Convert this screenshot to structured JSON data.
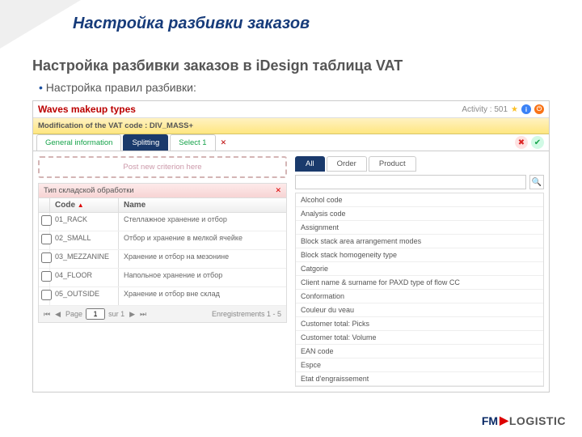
{
  "slide": {
    "title": "Настройка разбивки заказов",
    "subtitle": "Настройка разбивки заказов в iDesign таблица VAT",
    "bullet": "Настройка правил разбивки:"
  },
  "app": {
    "header_title": "Waves makeup types",
    "activity_label": "Activity : 501",
    "subbar": "Modification of the VAT code : DIV_MASS+",
    "tabs": [
      "General information",
      "Splitting",
      "Select 1"
    ],
    "criterion_placeholder": "Post new criterion here",
    "grid_title": "Тип складской обработки",
    "col_code": "Code",
    "col_name": "Name",
    "rows": [
      {
        "code": "01_RACK",
        "name": "Стеллажное хранение и отбор"
      },
      {
        "code": "02_SMALL",
        "name": "Отбор и хранение в мелкой ячейке"
      },
      {
        "code": "03_MEZZANINE",
        "name": "Хранение и отбор на мезонине"
      },
      {
        "code": "04_FLOOR",
        "name": "Напольное хранение и отбор"
      },
      {
        "code": "05_OUTSIDE",
        "name": "Хранение и отбор вне склад"
      }
    ],
    "pager": {
      "page_label": "Page",
      "page": "1",
      "of_label": "sur 1",
      "records": "Enregistrements 1 - 5"
    },
    "right_tabs": [
      "All",
      "Order",
      "Product"
    ],
    "search_placeholder": "",
    "right_list": [
      "Alcohol code",
      "Analysis code",
      "Assignment",
      "Block stack area arrangement modes",
      "Block stack homogeneity type",
      "Catgorie",
      "Client name & surname for PAXD type of flow CC",
      "Conformation",
      "Couleur du veau",
      "Customer total: Picks",
      "Customer total: Volume",
      "EAN code",
      "Espce",
      "Etat d'engraissement"
    ]
  },
  "logo": {
    "fm": "FM",
    "lg": "LOGISTIC"
  }
}
